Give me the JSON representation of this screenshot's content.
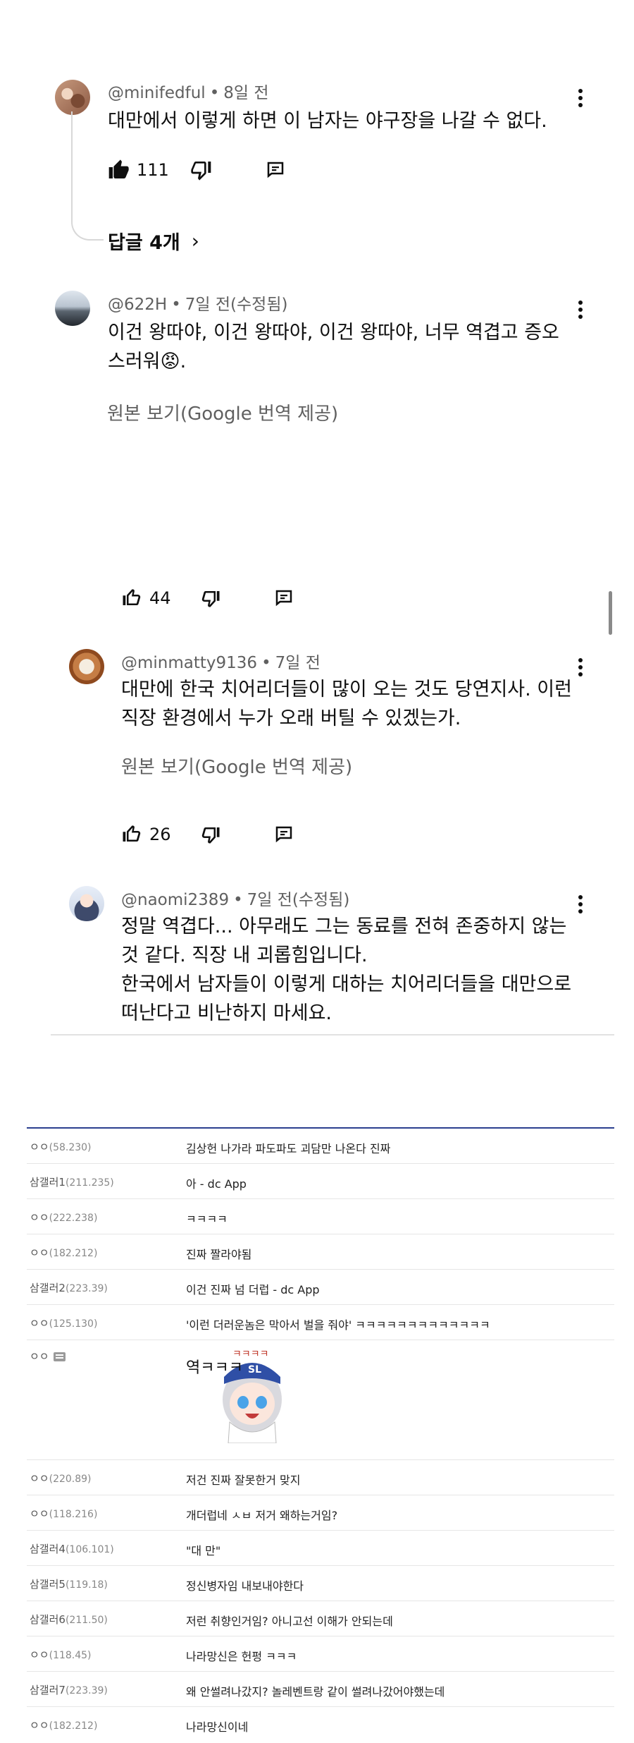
{
  "yt_comments": [
    {
      "author": "@minifedful",
      "time": "8일 전",
      "lines": [
        "대만에서 이렇게 하면 이 남자는 야구장을 나갈 수 없다."
      ],
      "likes": "111",
      "liked": true,
      "replies_label": "답글 4개"
    },
    {
      "author": "@622H",
      "time": "7일 전(수정됨)",
      "lines": [
        "이건 왕따야, 이건 왕따야, 이건 왕따야, 너무 역겹고 증오",
        "스러워😡."
      ],
      "translate": "원본 보기(Google 번역 제공)",
      "likes": "44"
    },
    {
      "author": "@minmatty9136",
      "time": "7일 전",
      "lines": [
        "대만에 한국 치어리더들이 많이 오는 것도 당연지사. 이런",
        "직장 환경에서 누가 오래 버틸 수 있겠는가."
      ],
      "translate": "원본 보기(Google 번역 제공)",
      "likes": "26"
    },
    {
      "author": "@naomi2389",
      "time": "7일 전(수정됨)",
      "lines": [
        "정말 역겹다... 아무래도 그는 동료를 전혀 존중하지 않는",
        "것 같다. 직장 내 괴롭힘입니다.",
        "한국에서 남자들이 이렇게 대하는 치어리더들을 대만으로",
        "떠난다고 비난하지 마세요."
      ]
    }
  ],
  "dc_comments": [
    {
      "nick": "ㅇㅇ",
      "ip": "(58.230)",
      "text": "김상헌 나가라 파도파도 괴담만 나온다 진짜"
    },
    {
      "nick": "삼갤러1",
      "ip": "(211.235)",
      "text": "아 - dc App"
    },
    {
      "nick": "ㅇㅇ",
      "ip": "(222.238)",
      "text": "ㅋㅋㅋㅋ"
    },
    {
      "nick": "ㅇㅇ",
      "ip": "(182.212)",
      "text": "진짜 짤라야됨"
    },
    {
      "nick": "삼갤러2",
      "ip": "(223.39)",
      "text": "이건 진짜 넘 더럽 - dc App"
    },
    {
      "nick": "ㅇㅇ",
      "ip": "(125.130)",
      "text": "'이런 더러운놈은 막아서 벌을 줘야' ㅋㅋㅋㅋㅋㅋㅋㅋㅋㅋㅋㅋㅋ"
    },
    {
      "nick": "ㅇㅇ",
      "ip": "",
      "text": "",
      "sticker": {
        "text_left": "역ㅋㅋㅋ",
        "text_top": "ㅋㅋㅋㅋ",
        "cap": "SL"
      }
    },
    {
      "nick": "ㅇㅇ",
      "ip": "(220.89)",
      "text": "저건 진짜 잘못한거 맞지"
    },
    {
      "nick": "ㅇㅇ",
      "ip": "(118.216)",
      "text": "개더럽네 ㅅㅂ 저거 왜하는거임?"
    },
    {
      "nick": "삼갤러4",
      "ip": "(106.101)",
      "text": "\"대 만\""
    },
    {
      "nick": "삼갤러5",
      "ip": "(119.18)",
      "text": "정신병자임 내보내야한다"
    },
    {
      "nick": "삼갤러6",
      "ip": "(211.50)",
      "text": "저런 취향인거임? 아니고선 이해가 안되는데"
    },
    {
      "nick": "ㅇㅇ",
      "ip": "(118.45)",
      "text": "나라망신은 헌펑 ㅋㅋㅋ"
    },
    {
      "nick": "삼갤러7",
      "ip": "(223.39)",
      "text": "왜 안썰려나갔지? 놀레벤트랑 같이 썰려나갔어야했는데"
    },
    {
      "nick": "ㅇㅇ",
      "ip": "(182.212)",
      "text": "나라망신이네"
    }
  ],
  "colors": {
    "dc_accent": "#2b3f8f",
    "meta_gray": "#606060"
  },
  "icons": [
    "like-icon",
    "dislike-icon",
    "reply-icon",
    "more-vert-icon",
    "chevron-right-icon",
    "comment-list-icon"
  ]
}
